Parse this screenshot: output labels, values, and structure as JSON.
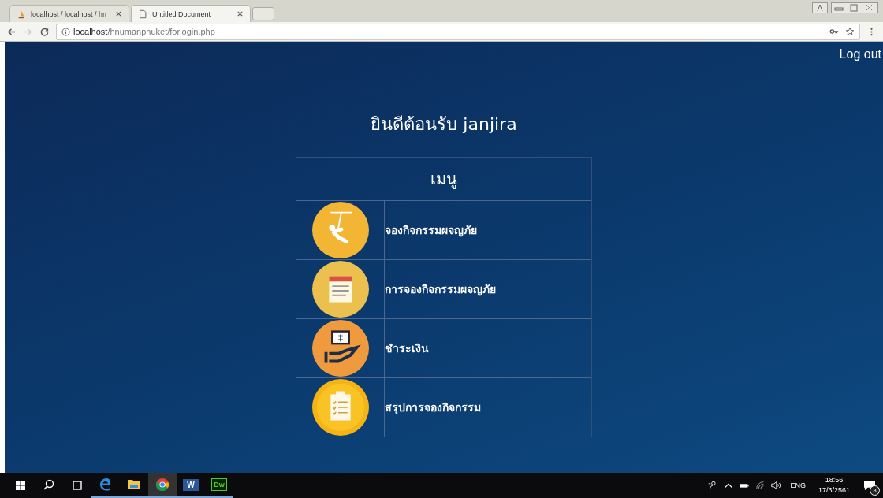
{
  "browser": {
    "tabs": [
      {
        "title": "localhost / localhost / hn",
        "selected": false,
        "kind": "php"
      },
      {
        "title": "Untitled Document",
        "selected": true,
        "kind": "doc"
      }
    ],
    "url_host": "localhost",
    "url_path": "/hnumanphuket/forlogin.php"
  },
  "page": {
    "logout": "Log out",
    "welcome": "ยินดีต้อนรับ  janjira",
    "menu_title": "เมนู",
    "menu_items": [
      {
        "label": "จองกิจกรรมผจญภัย",
        "kind": "zipline",
        "color": "#f3b534"
      },
      {
        "label": "การจองกิจกรรมผจญภัย",
        "kind": "calendar",
        "color": "#ebc04f"
      },
      {
        "label": "ชำระเงิน",
        "kind": "payment",
        "color": "#ef9a3c"
      },
      {
        "label": "สรุปการจองกิจกรรม",
        "kind": "clipboard",
        "color": "#f6b414"
      }
    ]
  },
  "taskbar": {
    "apps": [
      {
        "kind": "edge",
        "active": false
      },
      {
        "kind": "folder",
        "active": false
      },
      {
        "kind": "chrome",
        "active": true
      },
      {
        "kind": "word",
        "label": "W",
        "active": false
      },
      {
        "kind": "dw",
        "label": "Dw",
        "active": false
      }
    ],
    "language": "ENG",
    "time": "18:56",
    "date": "17/3/2561",
    "notifications": "3"
  }
}
